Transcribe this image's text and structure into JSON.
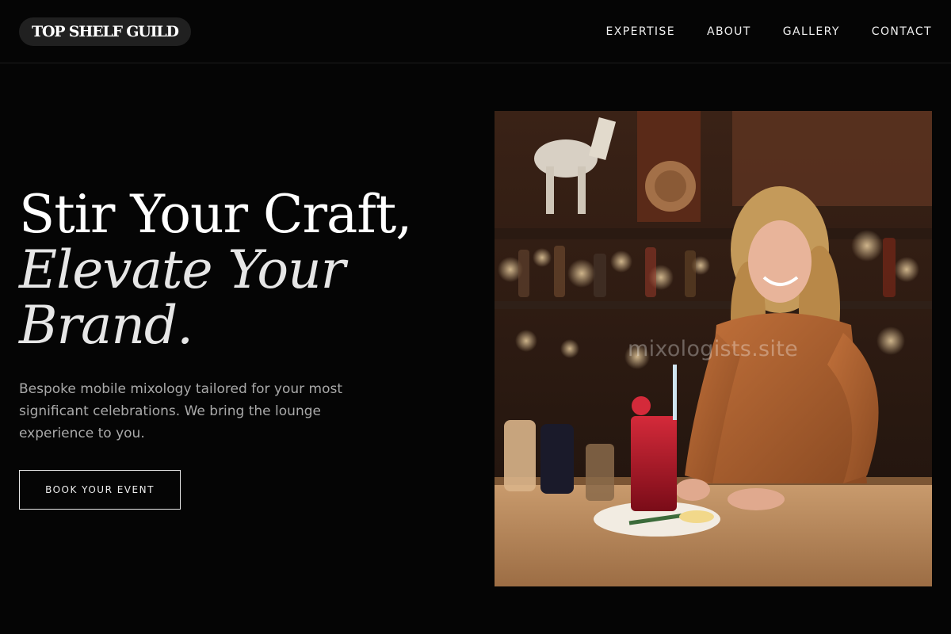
{
  "header": {
    "logo": "TOP SHELF GUILD",
    "nav": [
      {
        "label": "EXPERTISE"
      },
      {
        "label": "ABOUT"
      },
      {
        "label": "GALLERY"
      },
      {
        "label": "CONTACT"
      }
    ]
  },
  "hero": {
    "title_line1": "Stir Your Craft,",
    "title_line2": "Elevate Your",
    "title_line3": "Brand.",
    "subtitle": "Bespoke mobile mixology tailored for your most significant celebrations. We bring the lounge experience to you.",
    "cta_label": "BOOK YOUR EVENT"
  },
  "photo": {
    "watermark": "mixologists.site"
  },
  "colors": {
    "background": "#050505",
    "text": "#ffffff",
    "muted": "#a9a9a9",
    "logo_pill": "#202020"
  }
}
